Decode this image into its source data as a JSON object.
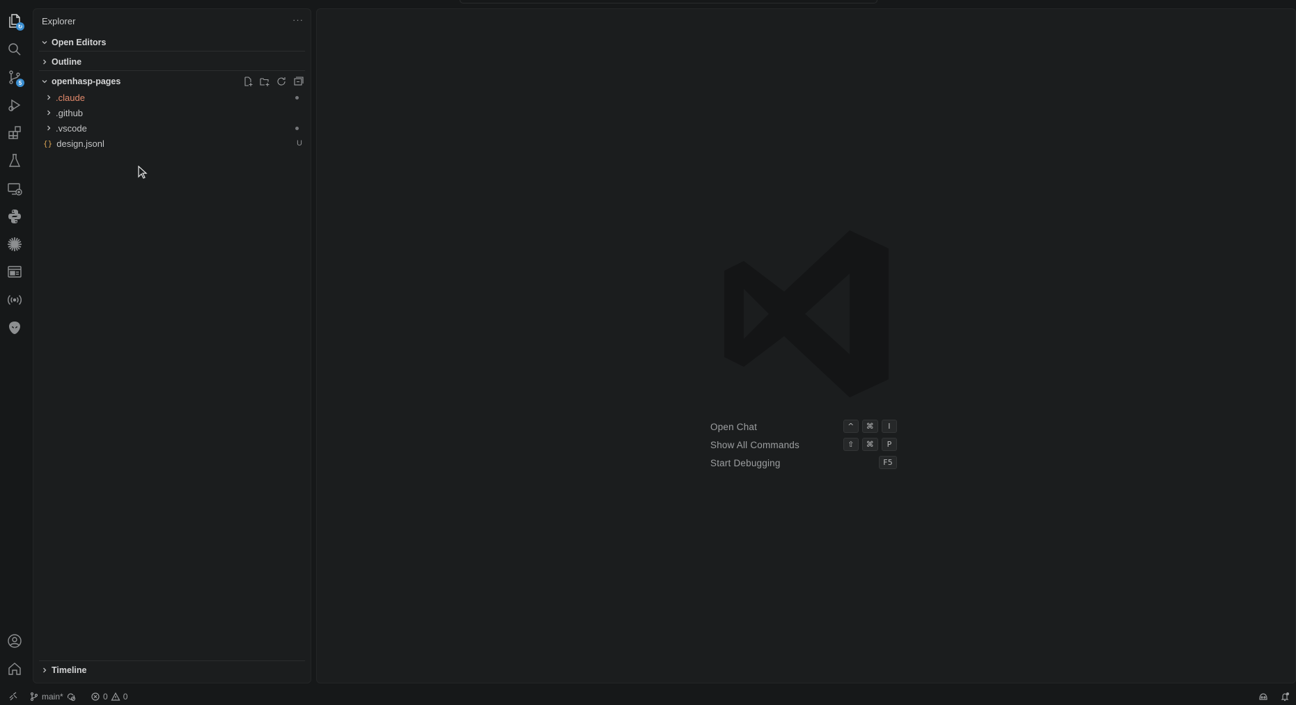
{
  "activity_bar": {
    "icons": [
      "explorer-icon",
      "search-icon",
      "source-control-icon",
      "run-debug-icon",
      "extensions-icon",
      "testing-icon",
      "remote-explorer-icon",
      "python-icon",
      "claude-icon",
      "preview-icon",
      "broadcast-icon",
      "alien-icon",
      "account-icon",
      "home-icon"
    ],
    "source_control_badge": "5"
  },
  "sidebar": {
    "title": "Explorer",
    "more": "···",
    "sections": {
      "open_editors": "Open Editors",
      "outline": "Outline",
      "project": "openhasp-pages",
      "timeline": "Timeline"
    },
    "tree": [
      {
        "name": ".claude",
        "type": "folder",
        "modified": true
      },
      {
        "name": ".github",
        "type": "folder",
        "modified": false
      },
      {
        "name": ".vscode",
        "type": "folder",
        "modified": false
      },
      {
        "name": "design.jsonl",
        "type": "file",
        "status": "U",
        "icon": "{}"
      }
    ]
  },
  "editor": {
    "shortcuts": [
      {
        "label": "Open Chat",
        "keys": [
          "^",
          "⌘",
          "I"
        ]
      },
      {
        "label": "Show All Commands",
        "keys": [
          "⇧",
          "⌘",
          "P"
        ]
      },
      {
        "label": "Start Debugging",
        "keys": [
          "F5"
        ]
      }
    ]
  },
  "statusbar": {
    "branch": "main*",
    "errors": "0",
    "warnings": "0"
  },
  "colors": {
    "background": "#161819",
    "panel": "#1b1d1e",
    "modified": "#e2896b",
    "json": "#d8a253",
    "badge": "#3b8ed0"
  }
}
